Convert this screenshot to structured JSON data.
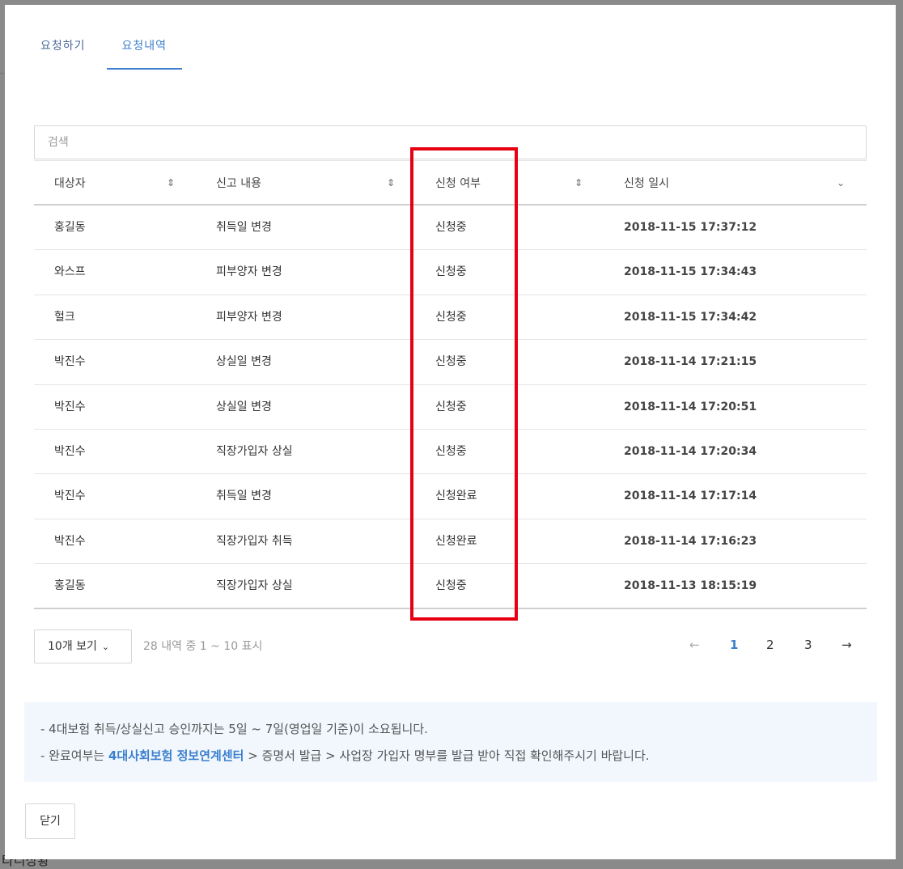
{
  "background": {
    "text": "타니상황"
  },
  "tabs": [
    {
      "label": "요청하기"
    },
    {
      "label": "요청내역",
      "active": true
    }
  ],
  "search": {
    "placeholder": "검색",
    "value": ""
  },
  "table": {
    "columns": [
      {
        "label": "대상자",
        "sort_icon": "sort-updown-icon"
      },
      {
        "label": "신고 내용",
        "sort_icon": "sort-updown-icon"
      },
      {
        "label": "신청 여부",
        "sort_icon": "sort-updown-icon"
      },
      {
        "label": "신청 일시",
        "sort_icon": "chevron-down-icon"
      }
    ],
    "rows": [
      {
        "target": "홍길동",
        "content": "취득일 변경",
        "status": "신청중",
        "datetime": "2018-11-15 17:37:12"
      },
      {
        "target": "와스프",
        "content": "피부양자 변경",
        "status": "신청중",
        "datetime": "2018-11-15 17:34:43"
      },
      {
        "target": "헐크",
        "content": "피부양자 변경",
        "status": "신청중",
        "datetime": "2018-11-15 17:34:42"
      },
      {
        "target": "박진수",
        "content": "상실일 변경",
        "status": "신청중",
        "datetime": "2018-11-14 17:21:15"
      },
      {
        "target": "박진수",
        "content": "상실일 변경",
        "status": "신청중",
        "datetime": "2018-11-14 17:20:51"
      },
      {
        "target": "박진수",
        "content": "직장가입자 상실",
        "status": "신청중",
        "datetime": "2018-11-14 17:20:34"
      },
      {
        "target": "박진수",
        "content": "취득일 변경",
        "status": "신청완료",
        "datetime": "2018-11-14 17:17:14"
      },
      {
        "target": "박진수",
        "content": "직장가입자 취득",
        "status": "신청완료",
        "datetime": "2018-11-14 17:16:23"
      },
      {
        "target": "홍길동",
        "content": "직장가입자 상실",
        "status": "신청중",
        "datetime": "2018-11-13 18:15:19"
      }
    ]
  },
  "pagination": {
    "page_size_label": "10개 보기",
    "summary": "28 내역 중 1 ~ 10 표시",
    "prev": "←",
    "pages": [
      "1",
      "2",
      "3"
    ],
    "current_page": "1",
    "next": "→"
  },
  "notice": {
    "line1": "- 4대보험 취득/상실신고 승인까지는 5일 ~ 7일(영업일 기준)이 소요됩니다.",
    "line2_prefix": "- 완료여부는 ",
    "line2_link": "4대사회보험 정보연계센터",
    "line2_suffix": " > 증명서 발급 > 사업장 가입자 명부를 발급 받아 직접 확인해주시기 바랍니다."
  },
  "close_button": {
    "label": "닫기"
  },
  "colors": {
    "accent": "#3c7fcf",
    "highlight": "#e60012",
    "notice_bg": "#f1f7fd"
  }
}
